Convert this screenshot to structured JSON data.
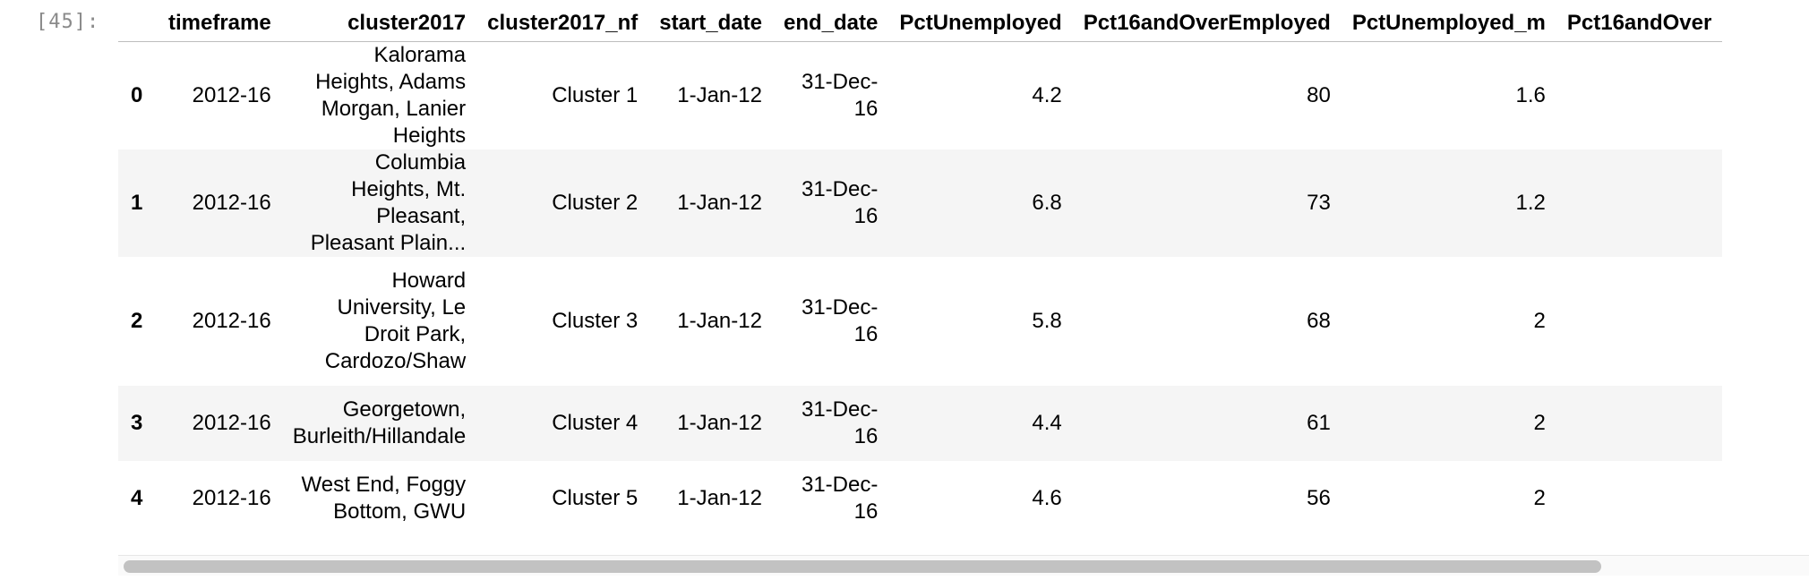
{
  "cell": {
    "prompt": "[45]:"
  },
  "table": {
    "columns": [
      "",
      "timeframe",
      "cluster2017",
      "cluster2017_nf",
      "start_date",
      "end_date",
      "PctUnemployed",
      "Pct16andOverEmployed",
      "PctUnemployed_m",
      "Pct16andOver"
    ],
    "rows": [
      {
        "index": "0",
        "timeframe": "2012-16",
        "cluster2017": "Kalorama Heights, Adams Morgan, Lanier Heights",
        "cluster2017_nf": "Cluster 1",
        "start_date": "1-Jan-12",
        "end_date": "31-Dec-16",
        "PctUnemployed": "4.2",
        "Pct16andOverEmployed": "80",
        "PctUnemployed_m": "1.6",
        "Pct16andOver": ""
      },
      {
        "index": "1",
        "timeframe": "2012-16",
        "cluster2017": "Columbia Heights, Mt. Pleasant, Pleasant Plain...",
        "cluster2017_nf": "Cluster 2",
        "start_date": "1-Jan-12",
        "end_date": "31-Dec-16",
        "PctUnemployed": "6.8",
        "Pct16andOverEmployed": "73",
        "PctUnemployed_m": "1.2",
        "Pct16andOver": ""
      },
      {
        "index": "2",
        "timeframe": "2012-16",
        "cluster2017": "Howard University, Le Droit Park, Cardozo/Shaw",
        "cluster2017_nf": "Cluster 3",
        "start_date": "1-Jan-12",
        "end_date": "31-Dec-16",
        "PctUnemployed": "5.8",
        "Pct16andOverEmployed": "68",
        "PctUnemployed_m": "2",
        "Pct16andOver": ""
      },
      {
        "index": "3",
        "timeframe": "2012-16",
        "cluster2017": "Georgetown, Burleith/Hillandale",
        "cluster2017_nf": "Cluster 4",
        "start_date": "1-Jan-12",
        "end_date": "31-Dec-16",
        "PctUnemployed": "4.4",
        "Pct16andOverEmployed": "61",
        "PctUnemployed_m": "2",
        "Pct16andOver": ""
      },
      {
        "index": "4",
        "timeframe": "2012-16",
        "cluster2017": "West End, Foggy Bottom, GWU",
        "cluster2017_nf": "Cluster 5",
        "start_date": "1-Jan-12",
        "end_date": "31-Dec-16",
        "PctUnemployed": "4.6",
        "Pct16andOverEmployed": "56",
        "PctUnemployed_m": "2",
        "Pct16andOver": ""
      }
    ]
  }
}
